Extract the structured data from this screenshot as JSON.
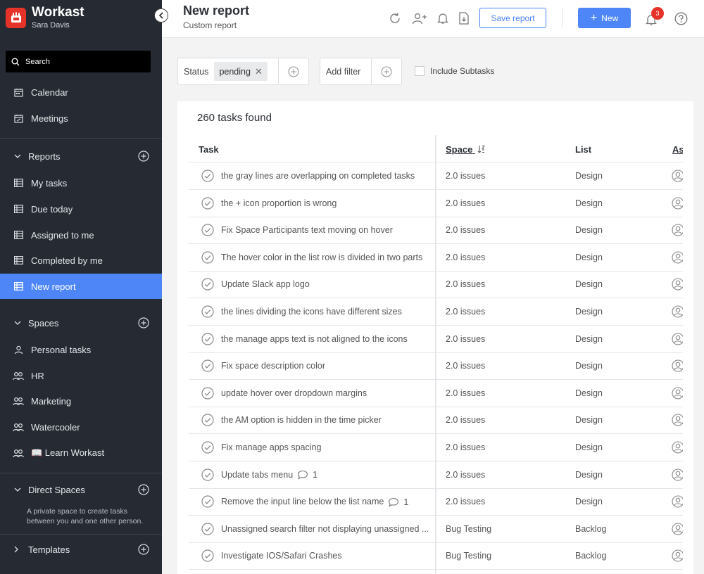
{
  "app": {
    "name": "Workast",
    "user": "Sara Davis"
  },
  "sidebar": {
    "search_label": "Search",
    "top_items": [
      {
        "label": "Calendar",
        "icon": "calendar-icon"
      },
      {
        "label": "Meetings",
        "icon": "meetings-icon"
      }
    ],
    "reports": {
      "title": "Reports",
      "items": [
        {
          "label": "My tasks",
          "icon": "table-icon"
        },
        {
          "label": "Due today",
          "icon": "table-icon"
        },
        {
          "label": "Assigned to me",
          "icon": "table-icon"
        },
        {
          "label": "Completed by me",
          "icon": "table-icon"
        },
        {
          "label": "New report",
          "icon": "table-icon",
          "active": true
        }
      ]
    },
    "spaces": {
      "title": "Spaces",
      "items": [
        {
          "label": "Personal tasks",
          "icon": "user-icon"
        },
        {
          "label": "HR",
          "icon": "users-icon"
        },
        {
          "label": "Marketing",
          "icon": "users-icon"
        },
        {
          "label": "Watercooler",
          "icon": "users-icon"
        },
        {
          "label": "📖 Learn Workast",
          "icon": "users-icon"
        }
      ]
    },
    "direct_spaces": {
      "title": "Direct Spaces",
      "note": "A private space to create tasks between you and one other person."
    },
    "templates": {
      "title": "Templates"
    }
  },
  "header": {
    "title": "New report",
    "subtitle": "Custom report",
    "save_label": "Save report",
    "new_label": "New",
    "notification_count": "3"
  },
  "filters": {
    "status_label": "Status",
    "status_value": "pending",
    "add_filter_label": "Add filter",
    "subtasks_label": "Include Subtasks"
  },
  "table": {
    "count_text": "260 tasks found",
    "columns": {
      "task": "Task",
      "space": "Space",
      "list": "List",
      "assignee": "As"
    },
    "rows": [
      {
        "task": "the gray lines are overlapping on completed tasks",
        "space": "2.0 issues",
        "list": "Design"
      },
      {
        "task": "the + icon proportion is wrong",
        "space": "2.0 issues",
        "list": "Design"
      },
      {
        "task": "Fix Space Participants text moving on hover",
        "space": "2.0 issues",
        "list": "Design"
      },
      {
        "task": "The hover color in the list row is divided in two parts",
        "space": "2.0 issues",
        "list": "Design"
      },
      {
        "task": "Update Slack app logo",
        "space": "2.0 issues",
        "list": "Design"
      },
      {
        "task": "the lines dividing the icons have different sizes",
        "space": "2.0 issues",
        "list": "Design"
      },
      {
        "task": "the manage apps text is not aligned to the icons",
        "space": "2.0 issues",
        "list": "Design"
      },
      {
        "task": "Fix space description color",
        "space": "2.0 issues",
        "list": "Design"
      },
      {
        "task": "update hover over dropdown margins",
        "space": "2.0 issues",
        "list": "Design"
      },
      {
        "task": "the AM option is hidden in the time picker",
        "space": "2.0 issues",
        "list": "Design"
      },
      {
        "task": "Fix manage apps spacing",
        "space": "2.0 issues",
        "list": "Design"
      },
      {
        "task": "Update tabs menu",
        "comments": "1",
        "space": "2.0 issues",
        "list": "Design"
      },
      {
        "task": "Remove the input line below the list name",
        "comments": "1",
        "space": "2.0 issues",
        "list": "Design"
      },
      {
        "task": "Unassigned search filter not displaying unassigned ...",
        "space": "Bug Testing",
        "list": "Backlog"
      },
      {
        "task": "Investigate IOS/Safari Crashes",
        "space": "Bug Testing",
        "list": "Backlog"
      }
    ]
  },
  "colors": {
    "sidebar_bg": "#262b33",
    "accent": "#4f86f7",
    "brand_red": "#e5332a"
  }
}
